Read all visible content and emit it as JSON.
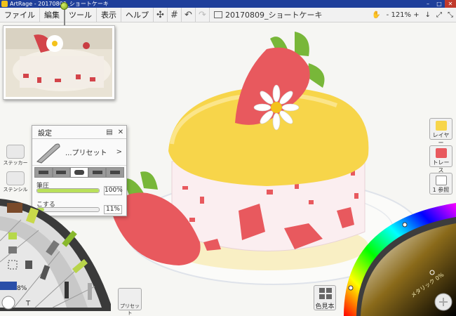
{
  "titlebar": {
    "title": "ArtRage - 20170809_ショートケーキ"
  },
  "menu": {
    "file": "ファイル",
    "edit": "編集",
    "tools": "ツール",
    "view": "表示",
    "help": "ヘルプ",
    "doc_title": "20170809_ショートケーキ",
    "zoom": "- 121% +"
  },
  "settings": {
    "title": "設定",
    "preset_label": "...プリセット",
    "params": [
      {
        "label": "筆圧",
        "value": "100%",
        "level": 1.0
      },
      {
        "label": "こする",
        "value": "11%",
        "level": 0.11
      }
    ]
  },
  "left_buttons": {
    "sticker": "ステッカー",
    "stencil": "ステンシル"
  },
  "tool_wheel": {
    "zoom_readout": "8%",
    "preset_button": "プリセット"
  },
  "right_buttons": {
    "layer": "レイヤー",
    "trace": "トレース",
    "reference": "1 参照"
  },
  "swatch_button": "色見本",
  "color_picker": {
    "metallic_label": "メタリック 0%"
  },
  "colors": {
    "titlebar": "#1f3f9a",
    "accent_green": "#b9e05a",
    "strawberry": "#e8595e",
    "cream": "#f7d54a"
  }
}
